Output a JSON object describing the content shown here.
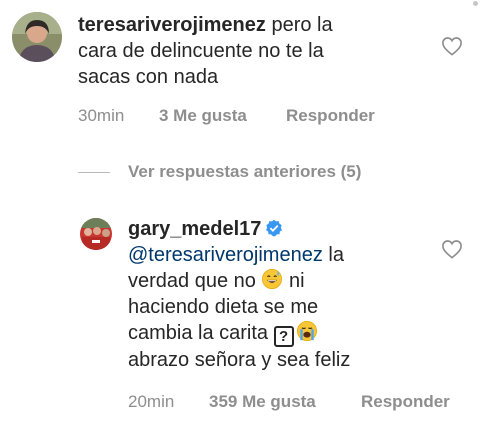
{
  "comments": [
    {
      "username": "teresariverojimenez",
      "text_line1": " pero la",
      "text_line2": "cara de delincuente no te la",
      "text_line3": "sacas con nada",
      "time": "30min",
      "likes": "3 Me gusta",
      "reply_label": "Responder"
    }
  ],
  "view_replies": {
    "label": "Ver respuestas anteriores (5)"
  },
  "replies": [
    {
      "username": "gary_medel17",
      "verified": true,
      "mention": "@teresariverojimenez",
      "text_line1_tail": " la",
      "text_line2_a": "verdad que no ",
      "text_line2_b": " ni",
      "text_line3": "haciendo dieta se me",
      "text_line4_a": "cambia la carita ",
      "question_box": "?",
      "text_line5": "abrazo señora y sea feliz",
      "time": "20min",
      "likes": "359 Me gusta",
      "reply_label": "Responder"
    }
  ],
  "icons": {
    "like": "heart-outline-icon",
    "verified": "verified-badge-icon",
    "emoji_sweat": "grinning-sweat-emoji",
    "emoji_cry": "loudly-crying-emoji"
  },
  "colors": {
    "text": "#262626",
    "secondary": "#8e8e8e",
    "mention": "#00376b",
    "verified": "#3897f0"
  }
}
